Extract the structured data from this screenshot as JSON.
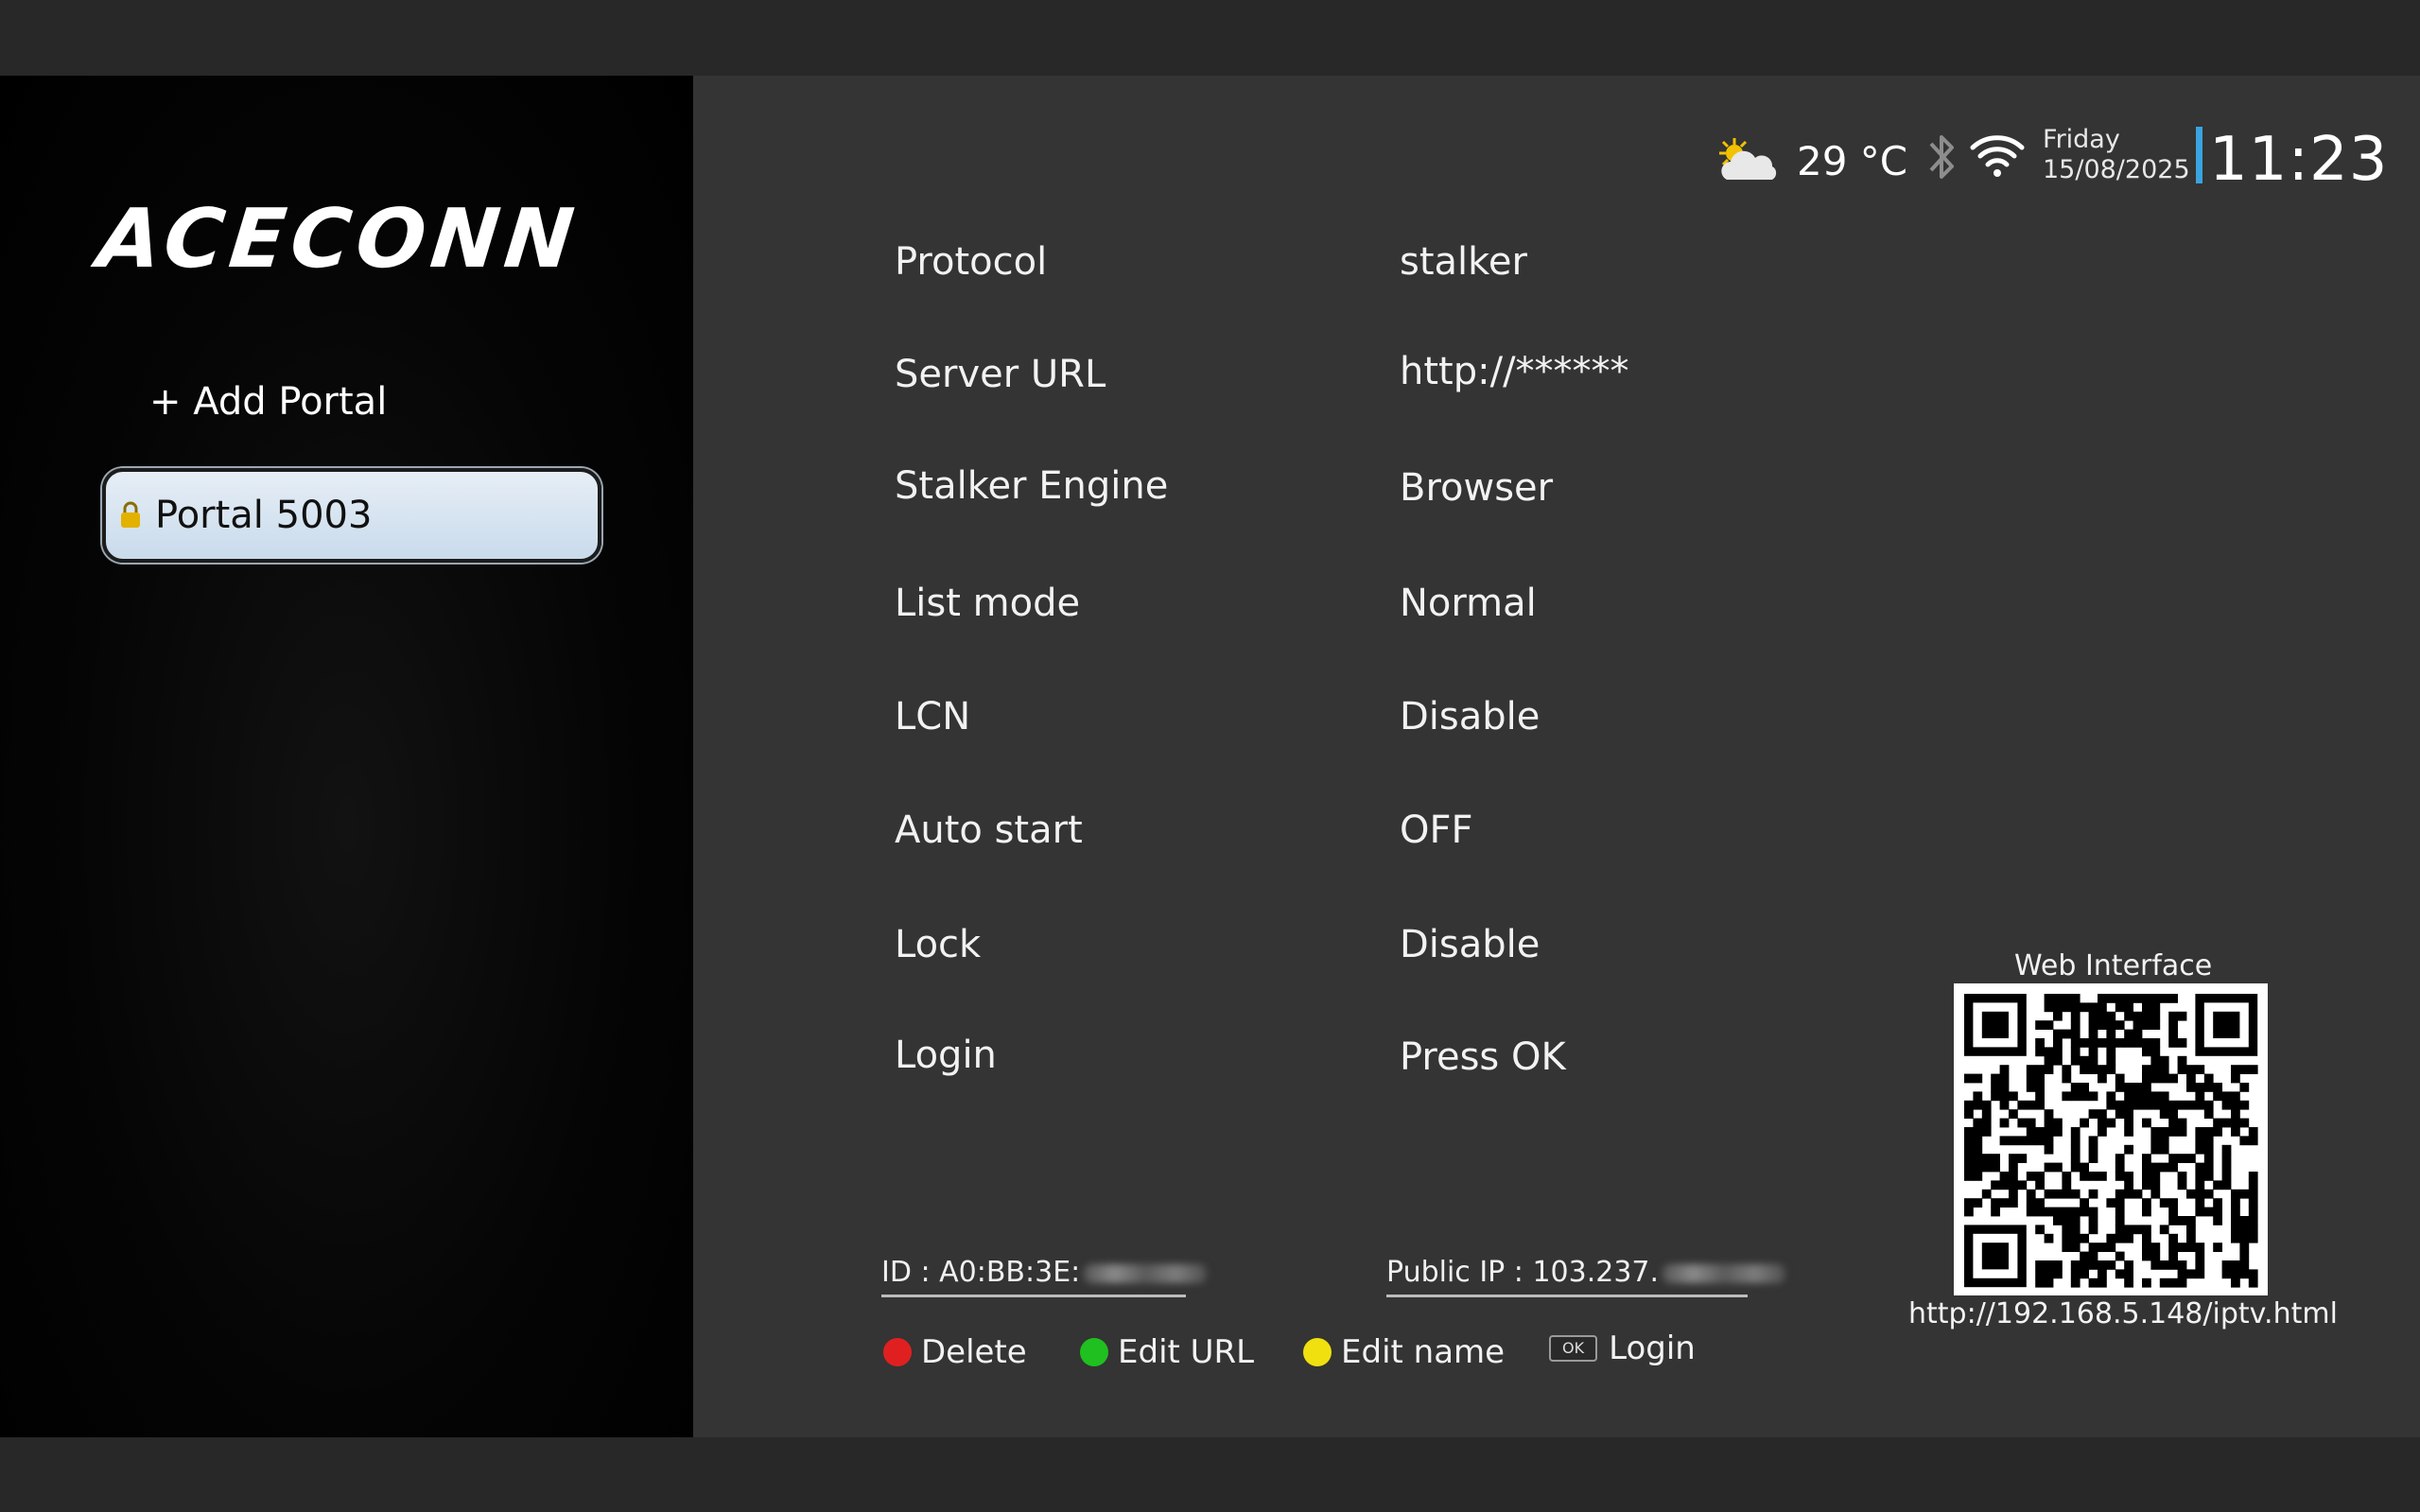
{
  "brand": {
    "logo_text": "ACECONN"
  },
  "sidebar": {
    "add_label": "+ Add Portal",
    "portals": [
      {
        "label": "Portal 5003",
        "locked": true,
        "selected": true
      }
    ]
  },
  "status_bar": {
    "weather_icon": "partly-cloudy-sun-icon",
    "temperature": "29 °C",
    "day": "Friday",
    "date": "15/08/2025",
    "time": "11:23",
    "accent_color": "#3aa3e0"
  },
  "settings": [
    {
      "label": "Protocol",
      "value": "stalker"
    },
    {
      "label": "Server URL",
      "value": "http://******"
    },
    {
      "label": "Stalker Engine",
      "value": "Browser"
    },
    {
      "label": "List mode",
      "value": "Normal"
    },
    {
      "label": "LCN",
      "value": "Disable"
    },
    {
      "label": "Auto start",
      "value": "OFF"
    },
    {
      "label": "Lock",
      "value": "Disable"
    },
    {
      "label": "Login",
      "value": "Press OK"
    }
  ],
  "footer": {
    "id_label": "ID : A0:BB:3E:",
    "public_ip_label": "Public IP : 103.237."
  },
  "actions": [
    {
      "label": "Delete",
      "color": "#e02020"
    },
    {
      "label": "Edit URL",
      "color": "#1fc01f"
    },
    {
      "label": "Edit name",
      "color": "#f0e010"
    },
    {
      "label": "Login",
      "key": "OK"
    }
  ],
  "web_interface": {
    "title": "Web Interface",
    "url": "http://192.168.5.148/iptv.html"
  }
}
